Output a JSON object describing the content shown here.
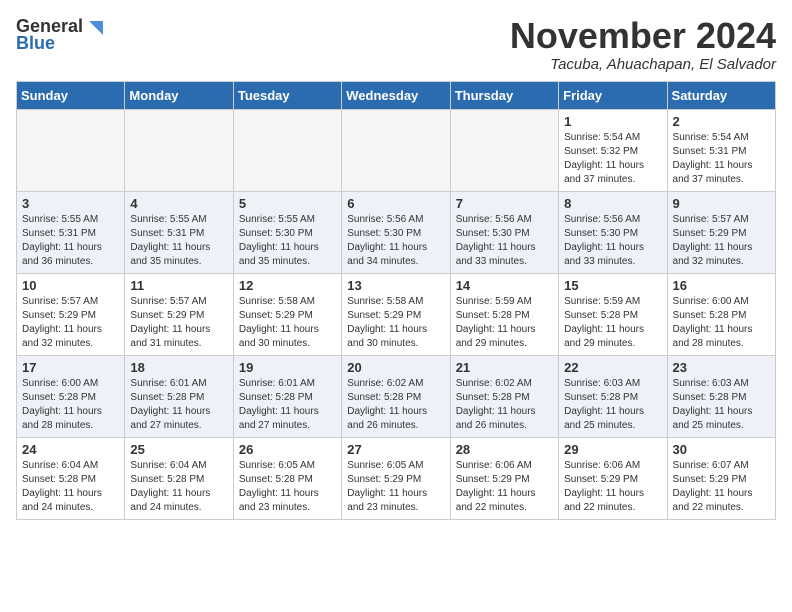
{
  "header": {
    "logo_general": "General",
    "logo_blue": "Blue",
    "month_title": "November 2024",
    "subtitle": "Tacuba, Ahuachapan, El Salvador"
  },
  "weekdays": [
    "Sunday",
    "Monday",
    "Tuesday",
    "Wednesday",
    "Thursday",
    "Friday",
    "Saturday"
  ],
  "weeks": [
    [
      {
        "day": "",
        "info": ""
      },
      {
        "day": "",
        "info": ""
      },
      {
        "day": "",
        "info": ""
      },
      {
        "day": "",
        "info": ""
      },
      {
        "day": "",
        "info": ""
      },
      {
        "day": "1",
        "info": "Sunrise: 5:54 AM\nSunset: 5:32 PM\nDaylight: 11 hours and 37 minutes."
      },
      {
        "day": "2",
        "info": "Sunrise: 5:54 AM\nSunset: 5:31 PM\nDaylight: 11 hours and 37 minutes."
      }
    ],
    [
      {
        "day": "3",
        "info": "Sunrise: 5:55 AM\nSunset: 5:31 PM\nDaylight: 11 hours and 36 minutes."
      },
      {
        "day": "4",
        "info": "Sunrise: 5:55 AM\nSunset: 5:31 PM\nDaylight: 11 hours and 35 minutes."
      },
      {
        "day": "5",
        "info": "Sunrise: 5:55 AM\nSunset: 5:30 PM\nDaylight: 11 hours and 35 minutes."
      },
      {
        "day": "6",
        "info": "Sunrise: 5:56 AM\nSunset: 5:30 PM\nDaylight: 11 hours and 34 minutes."
      },
      {
        "day": "7",
        "info": "Sunrise: 5:56 AM\nSunset: 5:30 PM\nDaylight: 11 hours and 33 minutes."
      },
      {
        "day": "8",
        "info": "Sunrise: 5:56 AM\nSunset: 5:30 PM\nDaylight: 11 hours and 33 minutes."
      },
      {
        "day": "9",
        "info": "Sunrise: 5:57 AM\nSunset: 5:29 PM\nDaylight: 11 hours and 32 minutes."
      }
    ],
    [
      {
        "day": "10",
        "info": "Sunrise: 5:57 AM\nSunset: 5:29 PM\nDaylight: 11 hours and 32 minutes."
      },
      {
        "day": "11",
        "info": "Sunrise: 5:57 AM\nSunset: 5:29 PM\nDaylight: 11 hours and 31 minutes."
      },
      {
        "day": "12",
        "info": "Sunrise: 5:58 AM\nSunset: 5:29 PM\nDaylight: 11 hours and 30 minutes."
      },
      {
        "day": "13",
        "info": "Sunrise: 5:58 AM\nSunset: 5:29 PM\nDaylight: 11 hours and 30 minutes."
      },
      {
        "day": "14",
        "info": "Sunrise: 5:59 AM\nSunset: 5:28 PM\nDaylight: 11 hours and 29 minutes."
      },
      {
        "day": "15",
        "info": "Sunrise: 5:59 AM\nSunset: 5:28 PM\nDaylight: 11 hours and 29 minutes."
      },
      {
        "day": "16",
        "info": "Sunrise: 6:00 AM\nSunset: 5:28 PM\nDaylight: 11 hours and 28 minutes."
      }
    ],
    [
      {
        "day": "17",
        "info": "Sunrise: 6:00 AM\nSunset: 5:28 PM\nDaylight: 11 hours and 28 minutes."
      },
      {
        "day": "18",
        "info": "Sunrise: 6:01 AM\nSunset: 5:28 PM\nDaylight: 11 hours and 27 minutes."
      },
      {
        "day": "19",
        "info": "Sunrise: 6:01 AM\nSunset: 5:28 PM\nDaylight: 11 hours and 27 minutes."
      },
      {
        "day": "20",
        "info": "Sunrise: 6:02 AM\nSunset: 5:28 PM\nDaylight: 11 hours and 26 minutes."
      },
      {
        "day": "21",
        "info": "Sunrise: 6:02 AM\nSunset: 5:28 PM\nDaylight: 11 hours and 26 minutes."
      },
      {
        "day": "22",
        "info": "Sunrise: 6:03 AM\nSunset: 5:28 PM\nDaylight: 11 hours and 25 minutes."
      },
      {
        "day": "23",
        "info": "Sunrise: 6:03 AM\nSunset: 5:28 PM\nDaylight: 11 hours and 25 minutes."
      }
    ],
    [
      {
        "day": "24",
        "info": "Sunrise: 6:04 AM\nSunset: 5:28 PM\nDaylight: 11 hours and 24 minutes."
      },
      {
        "day": "25",
        "info": "Sunrise: 6:04 AM\nSunset: 5:28 PM\nDaylight: 11 hours and 24 minutes."
      },
      {
        "day": "26",
        "info": "Sunrise: 6:05 AM\nSunset: 5:28 PM\nDaylight: 11 hours and 23 minutes."
      },
      {
        "day": "27",
        "info": "Sunrise: 6:05 AM\nSunset: 5:29 PM\nDaylight: 11 hours and 23 minutes."
      },
      {
        "day": "28",
        "info": "Sunrise: 6:06 AM\nSunset: 5:29 PM\nDaylight: 11 hours and 22 minutes."
      },
      {
        "day": "29",
        "info": "Sunrise: 6:06 AM\nSunset: 5:29 PM\nDaylight: 11 hours and 22 minutes."
      },
      {
        "day": "30",
        "info": "Sunrise: 6:07 AM\nSunset: 5:29 PM\nDaylight: 11 hours and 22 minutes."
      }
    ]
  ]
}
